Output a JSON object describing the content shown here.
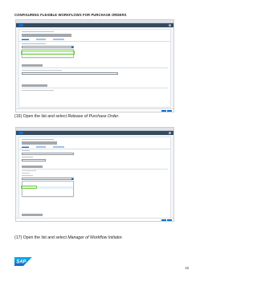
{
  "document": {
    "header": "CONFIGURING FLEXIBLE WORKFLOWS FOR PURCHASE ORDERS",
    "page_number": "15",
    "logo_text": "SAP"
  },
  "steps": [
    {
      "caption_prefix": "(16) Open the list and select ",
      "caption_emphasis": "Release of Purchase Order",
      "caption_suffix": "."
    },
    {
      "caption_prefix": "(17) Open the list and select ",
      "caption_emphasis": "Manager of Workflow Initiator",
      "caption_suffix": "."
    }
  ],
  "colors": {
    "shell": "#354a5f",
    "accent": "#0a6ed1",
    "highlight": "#6fcf3a"
  }
}
